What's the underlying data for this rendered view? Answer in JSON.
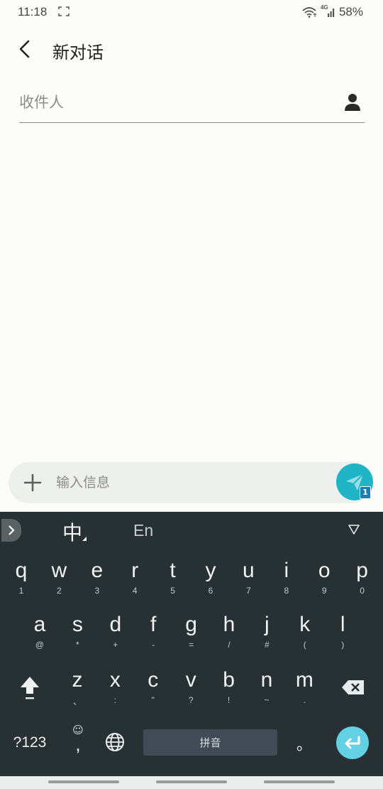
{
  "status_bar": {
    "time": "11:18",
    "network": "4G",
    "battery": "58%"
  },
  "app_bar": {
    "title": "新对话"
  },
  "recipient": {
    "placeholder": "收件人",
    "value": ""
  },
  "compose": {
    "placeholder": "输入信息",
    "value": "",
    "sim_badge": "1",
    "accent_color": "#1fb5c6"
  },
  "keyboard": {
    "lang_cn": "中",
    "lang_en": "En",
    "row1": [
      {
        "main": "q",
        "sub": "1"
      },
      {
        "main": "w",
        "sub": "2"
      },
      {
        "main": "e",
        "sub": "3"
      },
      {
        "main": "r",
        "sub": "4"
      },
      {
        "main": "t",
        "sub": "5"
      },
      {
        "main": "y",
        "sub": "6"
      },
      {
        "main": "u",
        "sub": "7"
      },
      {
        "main": "i",
        "sub": "8"
      },
      {
        "main": "o",
        "sub": "9"
      },
      {
        "main": "p",
        "sub": "0"
      }
    ],
    "row2": [
      {
        "main": "a",
        "sub": "@"
      },
      {
        "main": "s",
        "sub": "*"
      },
      {
        "main": "d",
        "sub": "+"
      },
      {
        "main": "f",
        "sub": "-"
      },
      {
        "main": "g",
        "sub": "="
      },
      {
        "main": "h",
        "sub": "/"
      },
      {
        "main": "j",
        "sub": "#"
      },
      {
        "main": "k",
        "sub": "("
      },
      {
        "main": "l",
        "sub": ")"
      }
    ],
    "row3": [
      {
        "main": "z",
        "sub": "、"
      },
      {
        "main": "x",
        "sub": ":"
      },
      {
        "main": "c",
        "sub": "\""
      },
      {
        "main": "v",
        "sub": "?"
      },
      {
        "main": "b",
        "sub": "!"
      },
      {
        "main": "n",
        "sub": "~"
      },
      {
        "main": "m",
        "sub": "."
      }
    ],
    "mode_label": "?123",
    "emoji_top": "☺",
    "emoji_main": ",",
    "space_label": "拼音",
    "period_label": "。"
  }
}
